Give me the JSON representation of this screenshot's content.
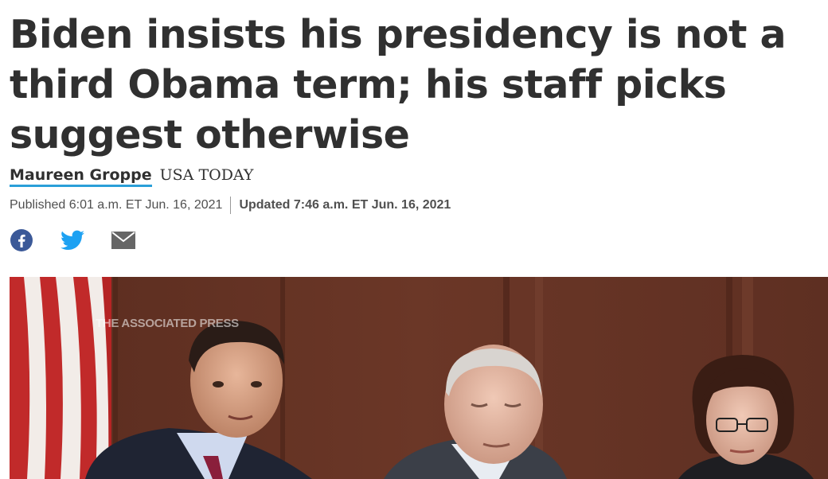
{
  "article": {
    "headline": "Biden insists his presidency is not a third Obama term; his staff picks suggest otherwise",
    "author": "Maureen Groppe",
    "outlet": "USA TODAY",
    "published": "Published 6:01 a.m. ET Jun. 16, 2021",
    "updated": "Updated 7:46 a.m. ET Jun. 16, 2021"
  },
  "share": {
    "icons": [
      "facebook-icon",
      "twitter-icon",
      "email-icon"
    ],
    "colors": {
      "facebook": "#3b5998",
      "twitter": "#1da1f2",
      "email": "#666666"
    }
  },
  "photo": {
    "watermark": "THE ASSOCIATED PRESS"
  },
  "colors": {
    "text": "#303030",
    "author_underline": "#2a9fd8",
    "meta": "#505050"
  }
}
